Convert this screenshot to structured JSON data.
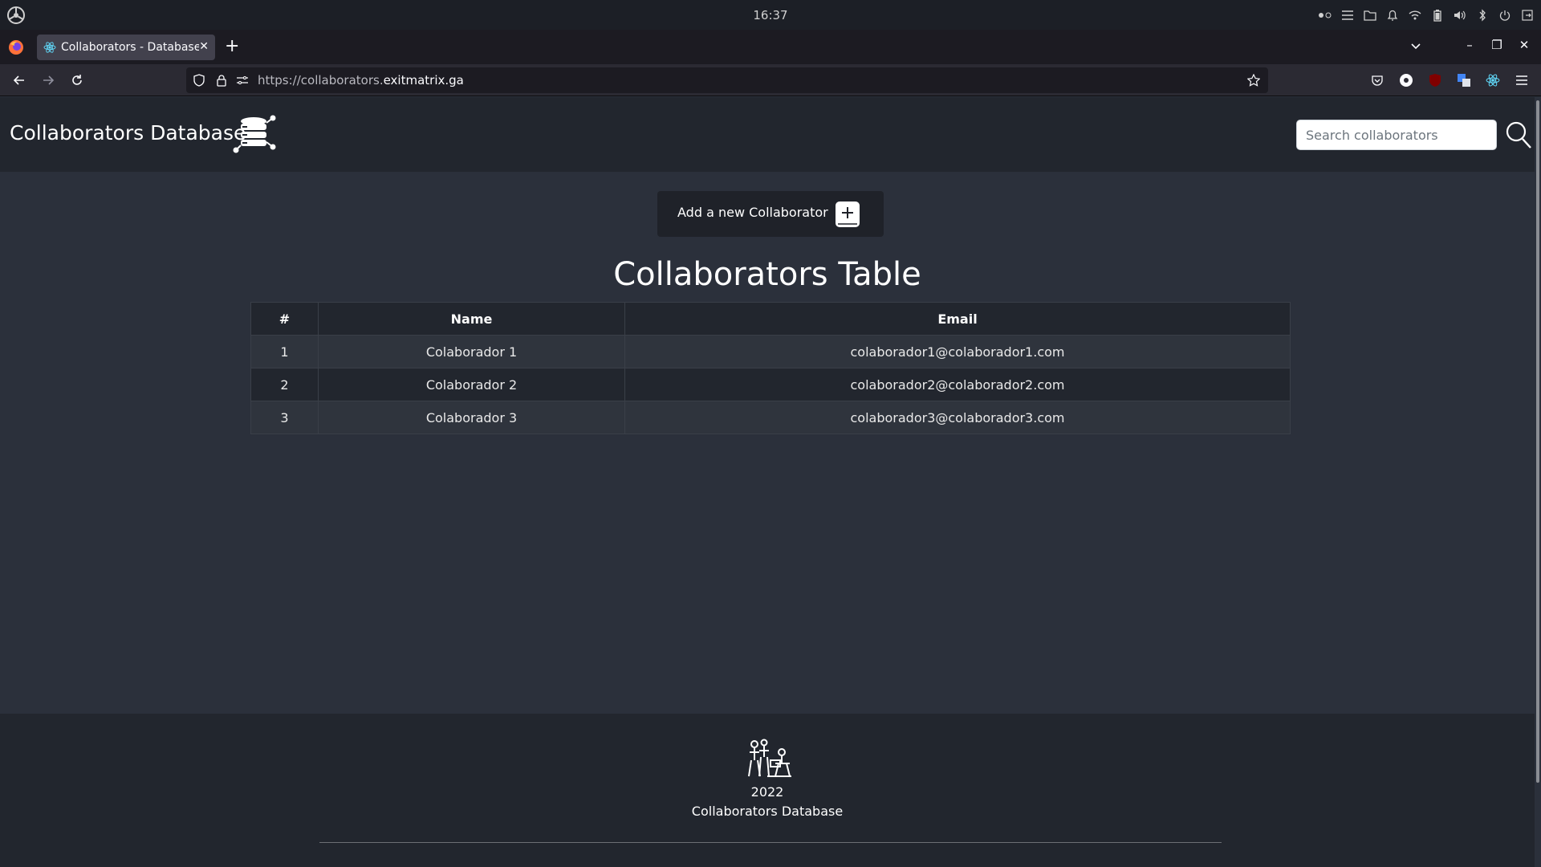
{
  "system": {
    "clock": "16:37",
    "tray_icons": [
      "workspace-indicator-icon",
      "menu-icon",
      "folder-icon",
      "bell-icon",
      "wifi-icon",
      "battery-icon",
      "volume-icon",
      "bluetooth-icon",
      "power-icon",
      "exit-icon"
    ]
  },
  "browser": {
    "tab_title": "Collaborators - Database",
    "url_prefix": "https://collaborators.",
    "url_host": "exitmatrix.ga",
    "url_suffix": ""
  },
  "header": {
    "brand": "Collaborators Database",
    "search_placeholder": "Search collaborators"
  },
  "main": {
    "add_button_label": "Add a new Collaborator",
    "table_title": "Collaborators Table",
    "table": {
      "columns": [
        "#",
        "Name",
        "Email"
      ],
      "rows": [
        [
          "1",
          "Colaborador 1",
          "colaborador1@colaborador1.com"
        ],
        [
          "2",
          "Colaborador 2",
          "colaborador2@colaborador2.com"
        ],
        [
          "3",
          "Colaborador 3",
          "colaborador3@colaborador3.com"
        ]
      ]
    }
  },
  "footer": {
    "year": "2022",
    "name": "Collaborators Database"
  },
  "colors": {
    "page_bg": "#2b303b",
    "header_bg": "#22262e",
    "button_bg": "#1f2229"
  }
}
